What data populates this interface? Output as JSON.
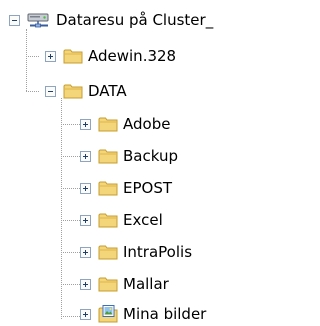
{
  "tree": {
    "root": {
      "label": "Dataresu på Cluster_",
      "icon": "network-drive-icon",
      "state": "expanded"
    },
    "items": [
      {
        "label": "Adewin.328",
        "icon": "folder-icon",
        "state": "collapsed"
      },
      {
        "label": "DATA",
        "icon": "folder-icon",
        "state": "expanded"
      }
    ],
    "data_children": [
      {
        "label": "Adobe",
        "icon": "folder-icon",
        "state": "collapsed"
      },
      {
        "label": "Backup",
        "icon": "folder-icon",
        "state": "collapsed"
      },
      {
        "label": "EPOST",
        "icon": "folder-icon",
        "state": "collapsed"
      },
      {
        "label": "Excel",
        "icon": "folder-icon",
        "state": "collapsed"
      },
      {
        "label": "IntraPolis",
        "icon": "folder-icon",
        "state": "collapsed"
      },
      {
        "label": "Mallar",
        "icon": "folder-icon",
        "state": "collapsed"
      },
      {
        "label": "Mina bilder",
        "icon": "my-pictures-folder-icon",
        "state": "collapsed"
      }
    ]
  },
  "colors": {
    "folder": "#f4d67a",
    "folder_edge": "#c59c2e",
    "expander_border": "#8ea4c1",
    "tree_lines": "#a0a0a0"
  }
}
